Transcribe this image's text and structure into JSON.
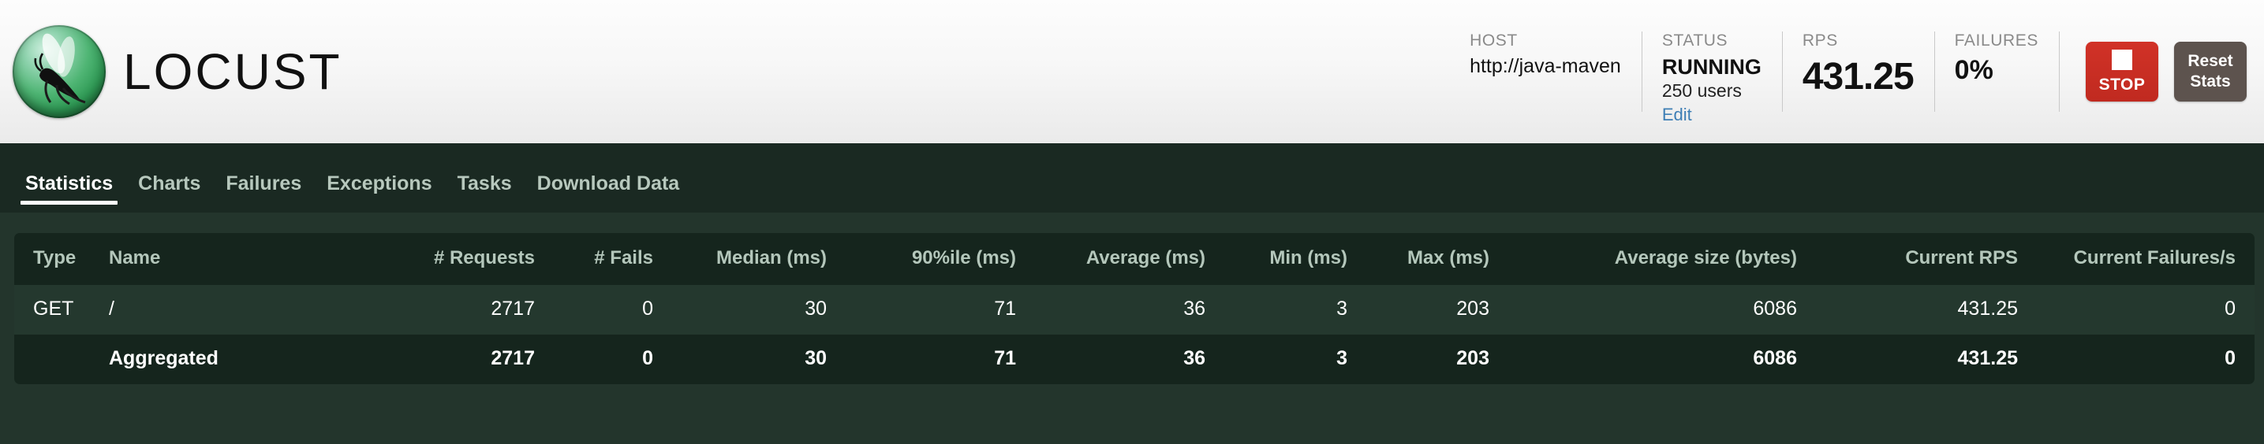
{
  "brand": {
    "name": "LOCUST",
    "logo_icon": "locust-sphere-icon"
  },
  "header_stats": {
    "host": {
      "label": "HOST",
      "value": "http://java-maven"
    },
    "status": {
      "label": "STATUS",
      "value": "RUNNING",
      "users": "250 users",
      "edit_label": "Edit"
    },
    "rps": {
      "label": "RPS",
      "value": "431.25"
    },
    "failures": {
      "label": "FAILURES",
      "value": "0%"
    }
  },
  "buttons": {
    "stop": {
      "label": "STOP",
      "icon": "stop-square-icon",
      "color": "#c72a20"
    },
    "reset": {
      "label_line1": "Reset",
      "label_line2": "Stats",
      "color": "#5d534e"
    }
  },
  "nav": {
    "items": [
      {
        "label": "Statistics",
        "active": true
      },
      {
        "label": "Charts",
        "active": false
      },
      {
        "label": "Failures",
        "active": false
      },
      {
        "label": "Exceptions",
        "active": false
      },
      {
        "label": "Tasks",
        "active": false
      },
      {
        "label": "Download Data",
        "active": false
      }
    ]
  },
  "table": {
    "columns": [
      "Type",
      "Name",
      "# Requests",
      "# Fails",
      "Median (ms)",
      "90%ile (ms)",
      "Average (ms)",
      "Min (ms)",
      "Max (ms)",
      "Average size (bytes)",
      "Current RPS",
      "Current Failures/s"
    ],
    "rows": [
      {
        "type": "GET",
        "name": "/",
        "requests": "2717",
        "fails": "0",
        "median": "30",
        "p90": "71",
        "average": "36",
        "min": "3",
        "max": "203",
        "avg_size": "6086",
        "current_rps": "431.25",
        "current_failures": "0"
      }
    ],
    "total": {
      "type": "",
      "name": "Aggregated",
      "requests": "2717",
      "fails": "0",
      "median": "30",
      "p90": "71",
      "average": "36",
      "min": "3",
      "max": "203",
      "avg_size": "6086",
      "current_rps": "431.25",
      "current_failures": "0"
    }
  }
}
